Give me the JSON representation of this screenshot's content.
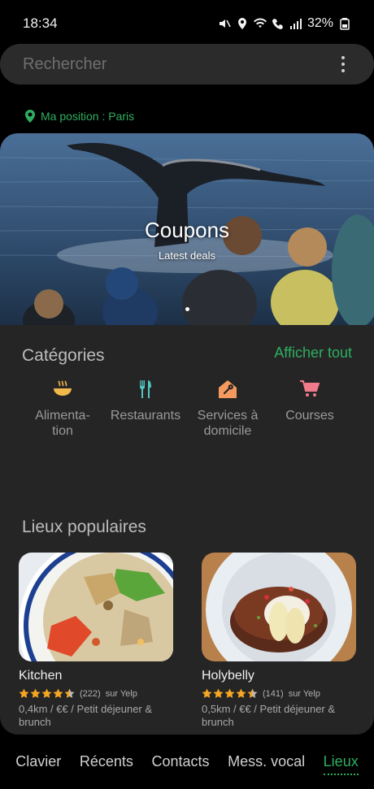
{
  "status": {
    "time": "18:34",
    "battery": "32%"
  },
  "search": {
    "placeholder": "Rechercher"
  },
  "location": {
    "label": "Ma position : Paris"
  },
  "banner": {
    "title": "Coupons",
    "subtitle": "Latest deals"
  },
  "categories": {
    "title": "Catégories",
    "show_all": "Afficher tout",
    "items": [
      {
        "label": "Alimenta-\ntion",
        "icon": "food-bowl-icon",
        "color": "#f2b84b"
      },
      {
        "label": "Restaurants",
        "icon": "fork-knife-icon",
        "color": "#4fc7c0"
      },
      {
        "label": "Services à domicile",
        "icon": "home-repair-icon",
        "color": "#f59a5e"
      },
      {
        "label": "Courses",
        "icon": "shopping-cart-icon",
        "color": "#f07a8a"
      }
    ]
  },
  "popular": {
    "title": "Lieux populaires",
    "places": [
      {
        "name": "Kitchen",
        "rating": 4.5,
        "count": "(222)",
        "source": "sur Yelp",
        "info": "0,4km / €€ / Petit déjeuner & brunch"
      },
      {
        "name": "Holybelly",
        "rating": 4.5,
        "count": "(141)",
        "source": "sur Yelp",
        "info": "0,5km / €€ / Petit déjeuner & brunch"
      }
    ]
  },
  "nav": {
    "items": [
      "Clavier",
      "Récents",
      "Contacts",
      "Mess. vocal",
      "Lieux"
    ],
    "active": "Lieux"
  },
  "colors": {
    "accent": "#2fae61",
    "star": "#f5a623"
  }
}
